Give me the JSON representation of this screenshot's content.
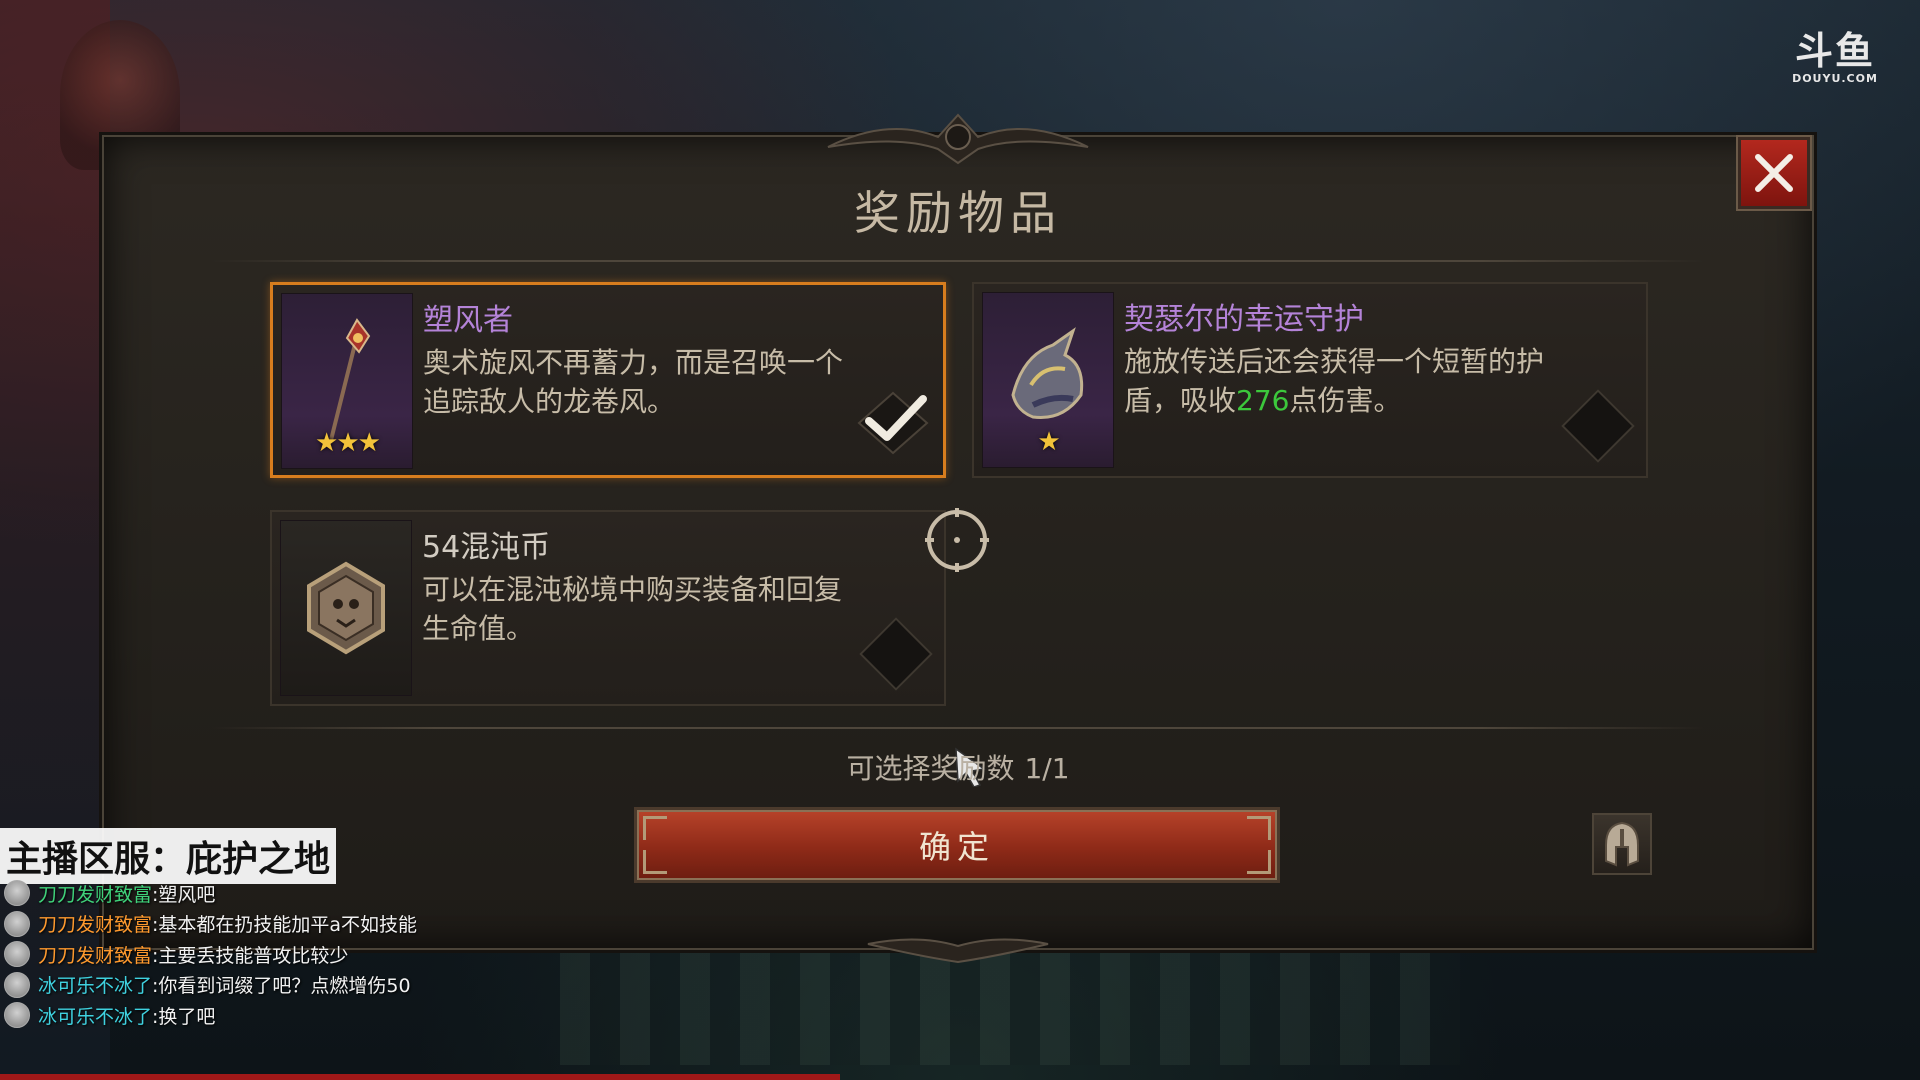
{
  "logo": {
    "mark": "斗鱼",
    "sub": "DOUYU.COM"
  },
  "dialog": {
    "title": "奖励物品",
    "close_icon": "close-icon",
    "rewards": [
      {
        "name": "塑风者",
        "description": "奥术旋风不再蓄力，而是召唤一个追踪敌人的龙卷风。",
        "stars": "★★★",
        "icon": "staff-icon",
        "selected": true
      },
      {
        "name": "契瑟尔的幸运守护",
        "description_before": "施放传送后还会获得一个短暂的护盾，吸收",
        "description_value": "276",
        "description_after": "点伤害。",
        "stars": "★",
        "icon": "dragon-shoulder-icon",
        "selected": false
      },
      {
        "name": "54混沌币",
        "description": "可以在混沌秘境中购买装备和回复生命值。",
        "icon": "chaos-coin-icon",
        "selected": false
      }
    ],
    "selection_label": "可选择奖励数",
    "selection_count": "1/1",
    "confirm_label": "确定",
    "helm_icon": "helmet-icon"
  },
  "stream": {
    "server_label": "主播区服：庇护之地",
    "chat": [
      {
        "user": "刀刀发财致富",
        "message": ":塑风吧"
      },
      {
        "user": "刀刀发财致富",
        "message": ":基本都在扔技能加平a不如技能"
      },
      {
        "user": "刀刀发财致富",
        "message": ":主要丢技能普攻比较少"
      },
      {
        "user": "冰可乐不冰了",
        "message": ":你看到词缀了吧？点燃增伤50"
      },
      {
        "user": "冰可乐不冰了",
        "message": ":换了吧"
      }
    ]
  },
  "colors": {
    "selected_border": "#d77d1e",
    "legendary_name": "#b483d8",
    "value_highlight": "#3cc83c",
    "star": "#f2c23a",
    "confirm_button": "#8e2a18",
    "close_button": "#b3281e"
  }
}
